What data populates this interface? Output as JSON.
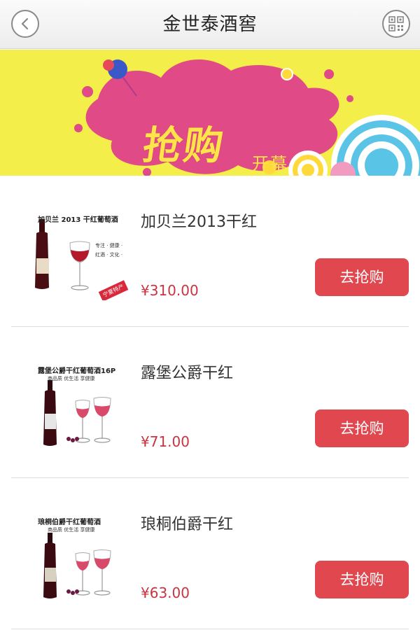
{
  "header": {
    "title": "金世泰酒窖",
    "back_icon": "chevron-left-icon",
    "qr_icon": "qr-code-icon"
  },
  "banner": {
    "main_text": "抢购",
    "sub_text": "开幕",
    "colors": {
      "background": "#f3ee4a",
      "splash": "#e04a86",
      "text": "#ffe34a"
    }
  },
  "products": [
    {
      "name": "加贝兰2013干红",
      "price": "¥310.00",
      "button": "去抢购",
      "image_caption": "加贝兰 2013 干红葡萄酒",
      "image_tagline": "专注 · 健康 ·\n红酒 · 文化 ·",
      "image_badge": "宁夏特产"
    },
    {
      "name": "露堡公爵干红",
      "price": "¥71.00",
      "button": "去抢购",
      "image_caption": "露堡公爵干红葡萄酒16P",
      "image_tagline": "商品质  优生活  享健康"
    },
    {
      "name": "琅桐伯爵干红",
      "price": "¥63.00",
      "button": "去抢购",
      "image_caption": "琅桐伯爵干红葡萄酒",
      "image_tagline": "商品质  优生活  享健康"
    }
  ],
  "colors": {
    "accent": "#e0474f",
    "price": "#c8343f"
  }
}
